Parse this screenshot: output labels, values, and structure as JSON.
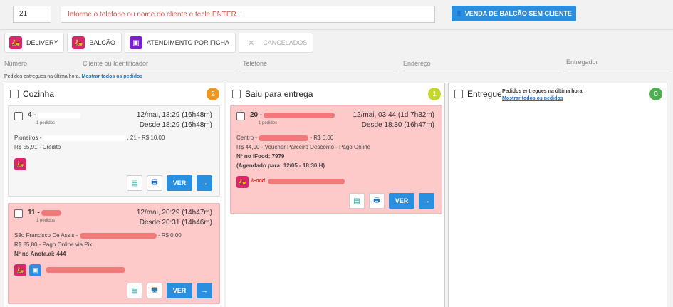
{
  "top": {
    "number_value": "21",
    "search_placeholder": "Informe o telefone ou nome do cliente e tecle ENTER...",
    "venda_button": "VENDA DE BALCÃO SEM CLIENTE"
  },
  "toolbar": {
    "delivery": "DELIVERY",
    "balcao": "BALCÃO",
    "ficha": "ATENDIMENTO POR FICHA",
    "cancelados": "CANCELADOS"
  },
  "filters": {
    "numero": "Número",
    "cliente": "Cliente ou Identificador",
    "telefone": "Telefone",
    "endereco": "Endereço",
    "entregador": "Entregador"
  },
  "note": {
    "text": "Pedidos entregues na última hora.",
    "link": "Mostrar todos os pedidos"
  },
  "columns": {
    "cozinha": {
      "title": "Cozinha",
      "count": "2",
      "color": "#f0961e"
    },
    "saiu": {
      "title": "Saiu para entrega",
      "count": "1",
      "color": "#c3d62a"
    },
    "entregue": {
      "title": "Entregue",
      "count": "0",
      "color": "#4caf50",
      "note": "Pedidos entregues na última hora.",
      "link": "Mostrar todos os pedidos"
    }
  },
  "cards": {
    "c1": {
      "num": "4 -",
      "sub": "1 pedidos",
      "date1": "12/mai, 18:29 (16h48m)",
      "date2": "Desde 18:29 (16h48m)",
      "addr_a": "Pioneiros -",
      "addr_b": ", 21 - R$ 10,00",
      "pay": "R$ 55,91 - Crédito"
    },
    "c2": {
      "num": "11 -",
      "sub": "1 pedidos",
      "date1": "12/mai, 20:29 (14h47m)",
      "date2": "Desde 20:31 (14h46m)",
      "addr_a": "São Francisco De Assis -",
      "addr_b": "- R$ 0,00",
      "pay": "R$ 85,80 - Pago Online via Pix",
      "extra": "Nº no Anota.ai: 444"
    },
    "c3": {
      "num": "20 -",
      "sub": "1 pedidos",
      "date1": "12/mai, 03:44 (1d 7h32m)",
      "date2": "Desde 18:30 (16h47m)",
      "addr_a": "Centro -",
      "addr_b": "- R$ 0,00",
      "pay": "R$ 44,90 - Voucher Parceiro Desconto - Pago Online",
      "extra": "Nº no iFood: 7979",
      "sched": "(Agendado para: 12/05 - 18:30 H)",
      "brand": "iFood"
    }
  },
  "buttons": {
    "ver": "VER"
  },
  "icons": {
    "arrow": "→",
    "print": "🖶",
    "receipt": "▤",
    "moto": "🛵",
    "user": "👤",
    "close": "✕"
  }
}
